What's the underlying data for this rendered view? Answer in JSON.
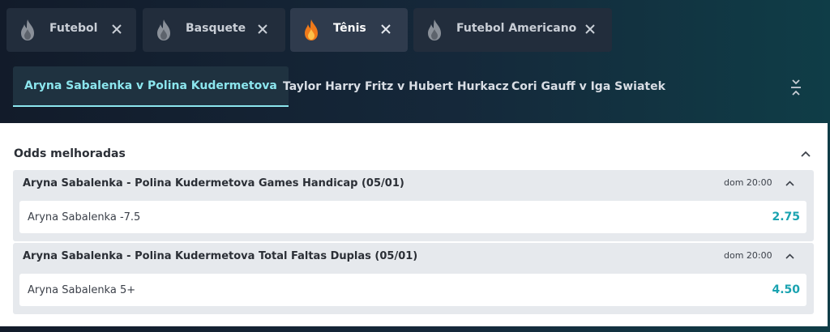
{
  "sport_tabs": [
    {
      "label": "Futebol",
      "icon": "flame-icon",
      "active": false
    },
    {
      "label": "Basquete",
      "icon": "flame-icon",
      "active": false
    },
    {
      "label": "Tênis",
      "icon": "flame-icon",
      "active": true
    },
    {
      "label": "Futebol Americano",
      "icon": "flame-icon",
      "active": false
    }
  ],
  "match_tabs": [
    {
      "label": "Aryna Sabalenka v Polina Kudermetova",
      "active": true
    },
    {
      "label": "Taylor Harry Fritz v Hubert Hurkacz",
      "active": false
    },
    {
      "label": "Cori Gauff v Iga Swiatek",
      "active": false
    }
  ],
  "section": {
    "title": "Odds melhoradas",
    "markets": [
      {
        "title": "Aryna Sabalenka - Polina Kudermetova Games Handicap (05/01)",
        "time": "dom 20:00",
        "selection": {
          "label": "Aryna Sabalenka -7.5",
          "odds": "2.75"
        }
      },
      {
        "title": "Aryna Sabalenka - Polina Kudermetova Total Faltas Duplas (05/01)",
        "time": "dom 20:00",
        "selection": {
          "label": "Aryna Sabalenka 5+",
          "odds": "4.50"
        }
      }
    ]
  },
  "colors": {
    "accent": "#8ce6ee",
    "odds": "#1aa3b0",
    "flame_active": "#f07a1a",
    "flame_inactive": "#8a9099"
  }
}
